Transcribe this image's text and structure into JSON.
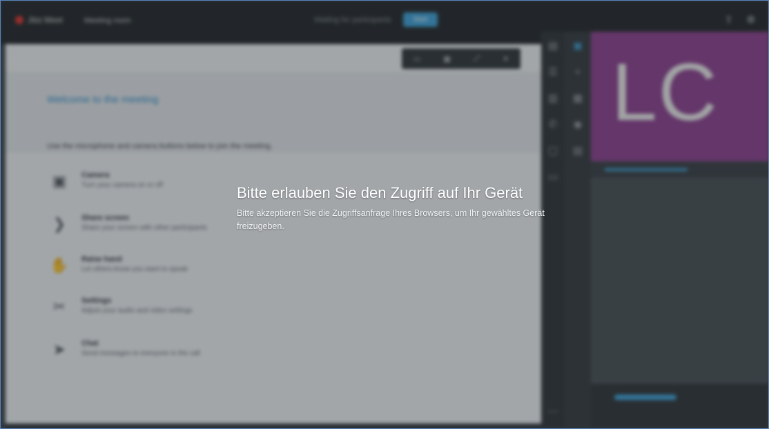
{
  "app": {
    "logo_text": "Jitsi Meet",
    "meeting_name": "Meeting room",
    "center_status": "Waiting for participants",
    "center_pill": "Start"
  },
  "toolbar_icons": [
    "share-icon",
    "settings-icon"
  ],
  "welcome": {
    "title": "Welcome to the meeting",
    "intro": "Use the microphone and camera buttons below to join the meeting.",
    "features": [
      {
        "icon": "camera-icon",
        "title": "Camera",
        "desc": "Turn your camera on or off"
      },
      {
        "icon": "share-screen-icon",
        "title": "Share screen",
        "desc": "Share your screen with other participants"
      },
      {
        "icon": "hand-icon",
        "title": "Raise hand",
        "desc": "Let others know you want to speak"
      },
      {
        "icon": "settings-icon",
        "title": "Settings",
        "desc": "Adjust your audio and video settings"
      },
      {
        "icon": "send-icon",
        "title": "Chat",
        "desc": "Send messages to everyone in the call"
      }
    ]
  },
  "participant": {
    "initials": "LC",
    "tile_color": "#8a3d8e"
  },
  "dialog": {
    "title": "Bitte erlauben Sie den Zugriff auf Ihr Gerät",
    "text": "Bitte akzeptieren Sie die Zugriffsanfrage Ihres Browsers, um Ihr gewähltes Gerät freizugeben."
  },
  "colors": {
    "accent": "#3aa0d8",
    "topbar": "#1f2327",
    "overlay": "#282c30"
  }
}
